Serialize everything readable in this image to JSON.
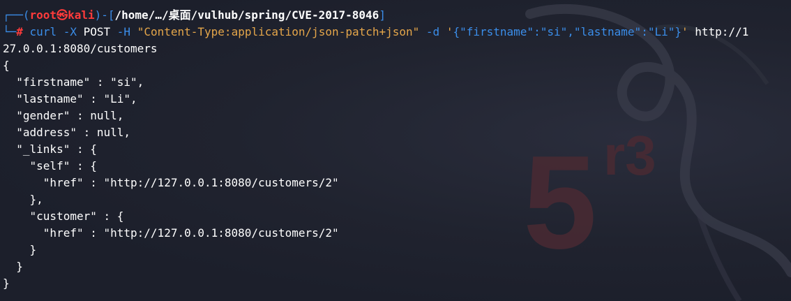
{
  "prompt": {
    "corner_top": "┌──(",
    "user": "root",
    "at_symbol": "㉿",
    "host": "kali",
    "sep": ")-[",
    "path": "/home/…/桌面/vulhub/spring/CVE-2017-8046",
    "path_close": "]",
    "corner_bottom": "└─",
    "hash": "#"
  },
  "command": {
    "program": "curl",
    "flag_x": "-X",
    "method": "POST",
    "flag_h": "-H",
    "header": "\"Content-Type:application/json-patch+json\"",
    "flag_d": "-d",
    "body_quote_open": "'",
    "body": "{\"firstname\":\"si\",\"lastname\":\"Li\"}",
    "body_quote_close": "'",
    "url_part1": "http://1",
    "url_part2": "27.0.0.1:8080/customers"
  },
  "output_lines": [
    "{",
    "  \"firstname\" : \"si\",",
    "  \"lastname\" : \"Li\",",
    "  \"gender\" : null,",
    "  \"address\" : null,",
    "  \"_links\" : {",
    "    \"self\" : {",
    "      \"href\" : \"http://127.0.0.1:8080/customers/2\"",
    "    },",
    "    \"customer\" : {",
    "      \"href\" : \"http://127.0.0.1:8080/customers/2\"",
    "    }",
    "  }",
    "}"
  ],
  "watermark": {
    "digit": "5",
    "superscript": "r3",
    "icon": "kali-dragon-icon"
  },
  "colors": {
    "background": "#1c1f2b",
    "prompt_blue": "#3b8eea",
    "prompt_red": "#ff3b3b",
    "string_orange": "#e5a64a",
    "watermark_red": "#5a2b30"
  }
}
